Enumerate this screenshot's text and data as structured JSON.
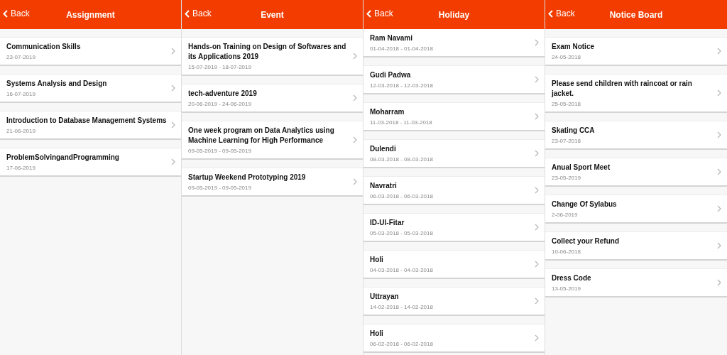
{
  "screens": [
    {
      "title": "Assignment",
      "back_label": "Back",
      "scrolled": false,
      "items": [
        {
          "title": "Communication Skills",
          "date": "23-07-2019"
        },
        {
          "title": "Systems Analysis and Design",
          "date": "16-07-2019"
        },
        {
          "title": "Introduction to Database Management Systems",
          "date": "21-06-2019"
        },
        {
          "title": "ProblemSolvingandProgramming",
          "date": "17-06-2019"
        }
      ]
    },
    {
      "title": "Event",
      "back_label": "Back",
      "scrolled": false,
      "items": [
        {
          "title": "Hands-on Training on Design of Softwares and its Applications 2019",
          "date": "15-07-2019 - 18-07-2019"
        },
        {
          "title": "tech-adventure 2019",
          "date": "20-06-2019 - 24-06-2019"
        },
        {
          "title": "One week  program on Data Analytics using Machine Learning for High Performance",
          "date": "09-05-2019 - 09-05-2019"
        },
        {
          "title": "Startup Weekend Prototyping 2019",
          "date": "09-05-2019 - 09-05-2019"
        }
      ]
    },
    {
      "title": "Holiday",
      "back_label": "Back",
      "scrolled": true,
      "items": [
        {
          "title": "Ram Navami",
          "date": "01-04-2018 - 01-04-2018"
        },
        {
          "title": "Gudi Padwa",
          "date": "12-03-2018 - 12-03-2018"
        },
        {
          "title": "Moharram",
          "date": "11-03-2018 - 11-03-2018"
        },
        {
          "title": "Dulendi",
          "date": "08-03-2018 - 08-03-2018"
        },
        {
          "title": "Navratri",
          "date": "06-03-2018 - 06-03-2018"
        },
        {
          "title": "ID-Ul-Fitar",
          "date": "05-03-2018 - 05-03-2018"
        },
        {
          "title": "Holi",
          "date": "04-03-2018 - 04-03-2018"
        },
        {
          "title": "Uttrayan",
          "date": "14-02-2018 - 14-02-2018"
        },
        {
          "title": "Holi",
          "date": "06-02-2018 - 06-02-2018"
        }
      ]
    },
    {
      "title": "Notice Board",
      "back_label": "Back",
      "scrolled": false,
      "items": [
        {
          "title": "Exam Notice",
          "date": "24-05-2018"
        },
        {
          "title": "Please send children with raincoat or rain jacket.",
          "date": "25-05-2018"
        },
        {
          "title": "Skating CCA",
          "date": "23-07-2018"
        },
        {
          "title": "Anual Sport Meet",
          "date": "23-05-2019"
        },
        {
          "title": "Change Of Sylabus",
          "date": "2-06-2019"
        },
        {
          "title": "Collect your Refund",
          "date": "10-06-2018"
        },
        {
          "title": "Dress Code",
          "date": "13-05-2019"
        }
      ]
    }
  ]
}
